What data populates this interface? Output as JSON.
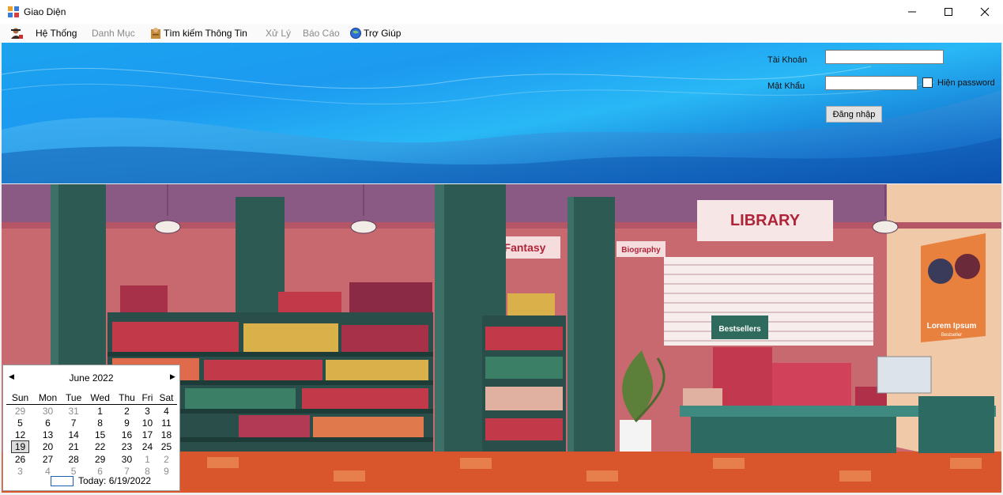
{
  "window": {
    "title": "Giao Diện",
    "controls": [
      "minimize",
      "maximize",
      "close"
    ]
  },
  "menu": {
    "items": [
      {
        "label": "Hệ Thống",
        "icon": "person-icon",
        "enabled": true
      },
      {
        "label": "Danh Mục",
        "icon": "",
        "enabled": false
      },
      {
        "label": "Tìm kiếm Thông Tin",
        "icon": "book-user-icon",
        "enabled": true
      },
      {
        "label": "Xử Lý",
        "icon": "",
        "enabled": false
      },
      {
        "label": "Báo Cáo",
        "icon": "",
        "enabled": false
      },
      {
        "label": "Trợ Giúp",
        "icon": "globe-help-icon",
        "enabled": true
      }
    ]
  },
  "login": {
    "username_label": "Tài Khoản",
    "username_value": "",
    "password_label": "Mật Khẩu",
    "password_value": "",
    "show_password_label": "Hiện password",
    "show_password_checked": false,
    "login_button": "Đăng nhập"
  },
  "scene": {
    "library_sign": "LIBRARY",
    "fantasy_sign": "Fantasy",
    "biography_sign": "Biography",
    "bestsellers_sign": "Bestsellers",
    "poster_title": "Lorem Ipsum",
    "poster_sub": "Bestseller"
  },
  "calendar": {
    "month_title": "June 2022",
    "weekdays": [
      "Sun",
      "Mon",
      "Tue",
      "Wed",
      "Thu",
      "Fri",
      "Sat"
    ],
    "weeks": [
      [
        [
          "29",
          true
        ],
        [
          "30",
          true
        ],
        [
          "31",
          true
        ],
        [
          "1",
          false
        ],
        [
          "2",
          false
        ],
        [
          "3",
          false
        ],
        [
          "4",
          false
        ]
      ],
      [
        [
          "5",
          false
        ],
        [
          "6",
          false
        ],
        [
          "7",
          false
        ],
        [
          "8",
          false
        ],
        [
          "9",
          false
        ],
        [
          "10",
          false
        ],
        [
          "11",
          false
        ]
      ],
      [
        [
          "12",
          false
        ],
        [
          "13",
          false
        ],
        [
          "14",
          false
        ],
        [
          "15",
          false
        ],
        [
          "16",
          false
        ],
        [
          "17",
          false
        ],
        [
          "18",
          false
        ]
      ],
      [
        [
          "19",
          false
        ],
        [
          "20",
          false
        ],
        [
          "21",
          false
        ],
        [
          "22",
          false
        ],
        [
          "23",
          false
        ],
        [
          "24",
          false
        ],
        [
          "25",
          false
        ]
      ],
      [
        [
          "26",
          false
        ],
        [
          "27",
          false
        ],
        [
          "28",
          false
        ],
        [
          "29",
          false
        ],
        [
          "30",
          false
        ],
        [
          "1",
          true
        ],
        [
          "2",
          true
        ]
      ],
      [
        [
          "3",
          true
        ],
        [
          "4",
          true
        ],
        [
          "5",
          true
        ],
        [
          "6",
          true
        ],
        [
          "7",
          true
        ],
        [
          "8",
          true
        ],
        [
          "9",
          true
        ]
      ]
    ],
    "selected_day": "19",
    "today_label": "Today: 6/19/2022"
  },
  "colors": {
    "banner_blue": "#1aa3ef",
    "wall_pink": "#c86a74",
    "shelf_teal": "#2f5e56",
    "floor_orange": "#d9552c"
  }
}
